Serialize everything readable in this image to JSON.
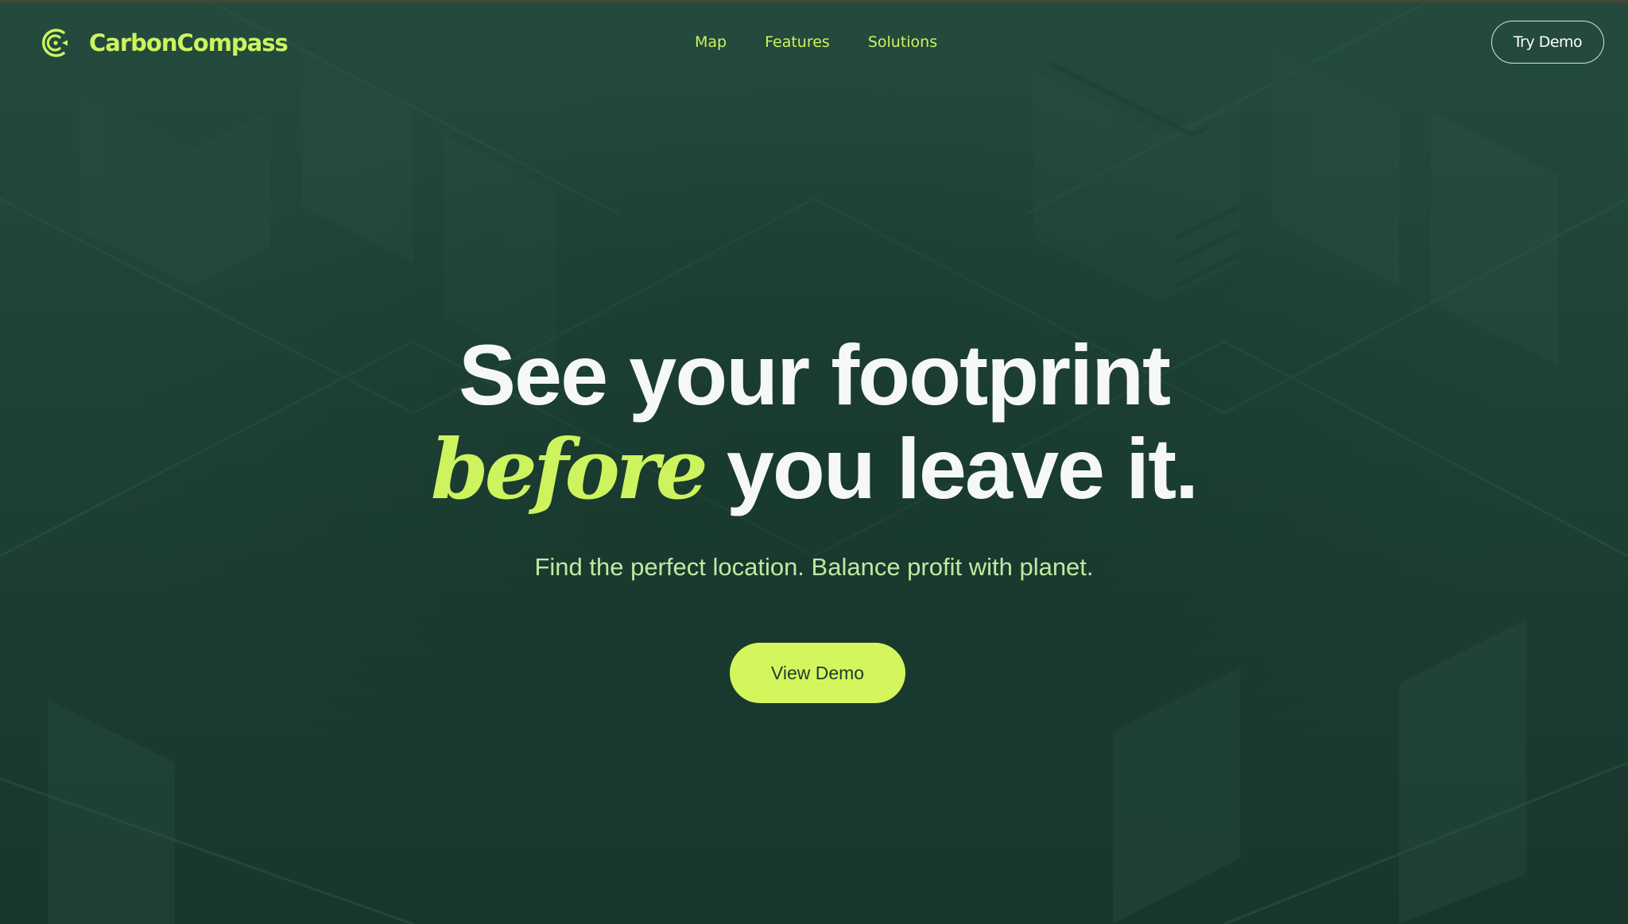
{
  "brand": {
    "name": "CarbonCompass",
    "logo_icon": "compass-c-icon"
  },
  "nav": {
    "links": [
      "Map",
      "Features",
      "Solutions"
    ]
  },
  "header": {
    "cta_label": "Try Demo"
  },
  "hero": {
    "line1": "See your footprint",
    "accent": "before",
    "line2_rest": " you leave it.",
    "subtitle": "Find the perfect location. Balance profit with planet.",
    "cta_label": "View Demo"
  },
  "colors": {
    "accent": "#cdf35e",
    "background": "#1d3d33",
    "headline": "#f6f8f6",
    "subtitle": "#bfeaa0",
    "button": "#d4f65d",
    "button_text": "#1d3b2f"
  }
}
